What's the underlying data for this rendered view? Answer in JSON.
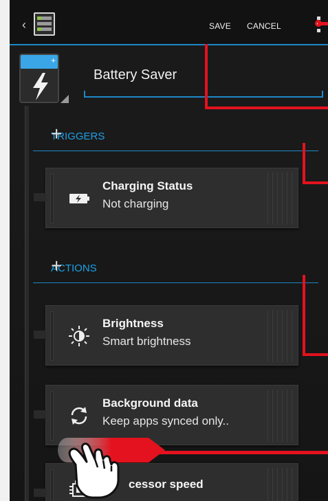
{
  "actionbar": {
    "save_label": "SAVE",
    "cancel_label": "CANCEL",
    "back_icon": "back-caret-icon",
    "app_icon": "profiles-app-icon",
    "overflow_icon": "overflow-menu-icon"
  },
  "profile": {
    "title": "Battery Saver",
    "icon": "battery-charge-icon"
  },
  "triggers": {
    "header": "TRIGGERS",
    "add_label": "+",
    "items": [
      {
        "title": "Charging Status",
        "subtitle": "Not charging",
        "icon": "battery-bolt-icon"
      }
    ]
  },
  "actions": {
    "header": "ACTIONS",
    "add_label": "+",
    "items": [
      {
        "title": "Brightness",
        "subtitle": "Smart brightness",
        "icon": "brightness-icon"
      },
      {
        "title": "Background data",
        "subtitle": "Keep apps synced only..",
        "icon": "sync-icon"
      },
      {
        "title": "cessor speed",
        "subtitle": "",
        "icon": "cpu-icon"
      }
    ]
  },
  "colors": {
    "accent": "#1e88c8",
    "callout": "#e3121e",
    "background": "#1a1a1a"
  }
}
